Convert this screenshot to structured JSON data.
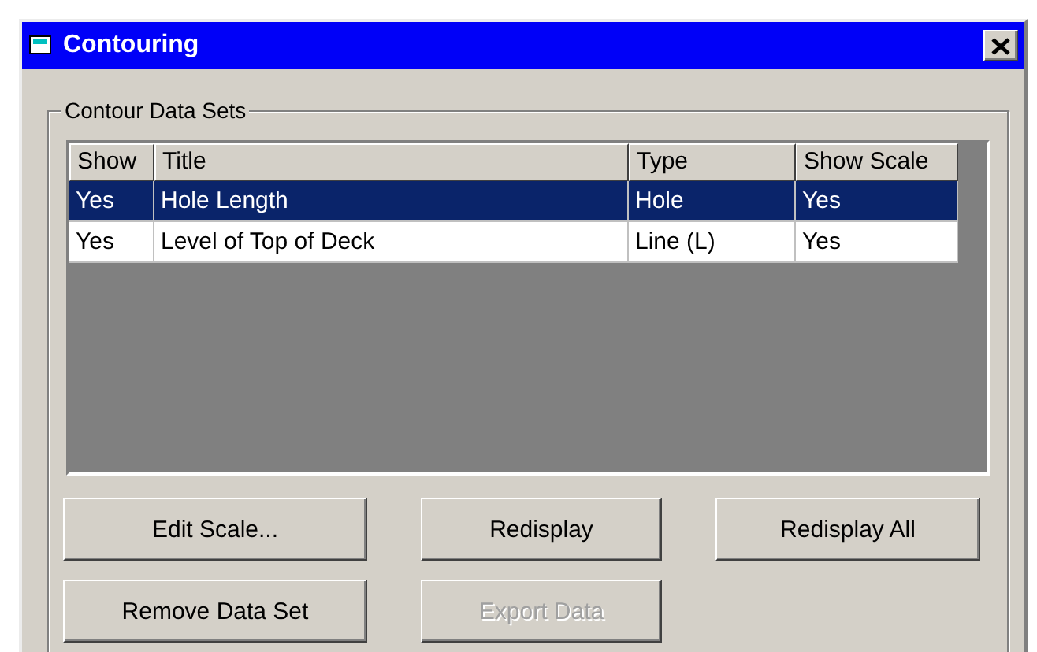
{
  "window": {
    "title": "Contouring"
  },
  "group": {
    "label": "Contour Data Sets"
  },
  "table": {
    "columns": [
      "Show",
      "Title",
      "Type",
      "Show Scale"
    ],
    "rows": [
      {
        "cells": [
          "Yes",
          "Hole Length",
          "Hole",
          "Yes"
        ],
        "selected": true
      },
      {
        "cells": [
          "Yes",
          "Level of Top of Deck",
          "Line (L)",
          "Yes"
        ],
        "selected": false
      }
    ]
  },
  "buttons": [
    {
      "label": "Edit Scale...",
      "disabled": false
    },
    {
      "label": "Redisplay",
      "disabled": false
    },
    {
      "label": "Redisplay All",
      "disabled": false
    },
    {
      "label": "Remove Data Set",
      "disabled": false
    },
    {
      "label": "Export Data",
      "disabled": true
    }
  ]
}
